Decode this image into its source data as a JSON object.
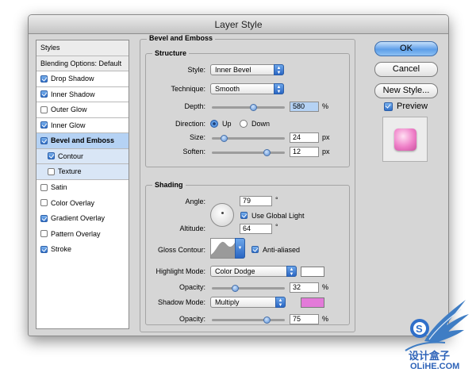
{
  "window": {
    "title": "Layer Style"
  },
  "styles_list": {
    "header": "Styles",
    "blending": "Blending Options: Default",
    "items": [
      {
        "label": "Drop Shadow",
        "checked": true
      },
      {
        "label": "Inner Shadow",
        "checked": true
      },
      {
        "label": "Outer Glow",
        "checked": false
      },
      {
        "label": "Inner Glow",
        "checked": true
      },
      {
        "label": "Bevel and Emboss",
        "checked": true
      },
      {
        "label": "Contour",
        "checked": true
      },
      {
        "label": "Texture",
        "checked": false
      },
      {
        "label": "Satin",
        "checked": false
      },
      {
        "label": "Color Overlay",
        "checked": false
      },
      {
        "label": "Gradient Overlay",
        "checked": true
      },
      {
        "label": "Pattern Overlay",
        "checked": false
      },
      {
        "label": "Stroke",
        "checked": true
      }
    ]
  },
  "bevel": {
    "title": "Bevel and Emboss",
    "structure": {
      "title": "Structure",
      "style_label": "Style:",
      "style_value": "Inner Bevel",
      "technique_label": "Technique:",
      "technique_value": "Smooth",
      "depth_label": "Depth:",
      "depth_value": "580",
      "depth_unit": "%",
      "direction_label": "Direction:",
      "direction_up": "Up",
      "direction_down": "Down",
      "size_label": "Size:",
      "size_value": "24",
      "size_unit": "px",
      "soften_label": "Soften:",
      "soften_value": "12",
      "soften_unit": "px"
    },
    "shading": {
      "title": "Shading",
      "angle_label": "Angle:",
      "angle_value": "79",
      "angle_unit": "°",
      "global_light_label": "Use Global Light",
      "altitude_label": "Altitude:",
      "altitude_value": "64",
      "altitude_unit": "°",
      "gloss_label": "Gloss Contour:",
      "antialiased_label": "Anti-aliased",
      "highlight_label": "Highlight Mode:",
      "highlight_value": "Color Dodge",
      "highlight_color": "#ffffff",
      "hl_opacity_label": "Opacity:",
      "hl_opacity_value": "32",
      "hl_opacity_unit": "%",
      "shadow_label": "Shadow Mode:",
      "shadow_value": "Multiply",
      "shadow_color": "#e37ad9",
      "sh_opacity_label": "Opacity:",
      "sh_opacity_value": "75",
      "sh_opacity_unit": "%"
    }
  },
  "buttons": {
    "ok": "OK",
    "cancel": "Cancel",
    "new_style": "New Style...",
    "preview": "Preview"
  },
  "watermark": {
    "line1": "设计盒子",
    "line2": "OLiHE.COM"
  },
  "sliders": {
    "depth": 0.57,
    "size": 0.16,
    "soften": 0.75,
    "hl_opacity": 0.32,
    "sh_opacity": 0.75
  }
}
